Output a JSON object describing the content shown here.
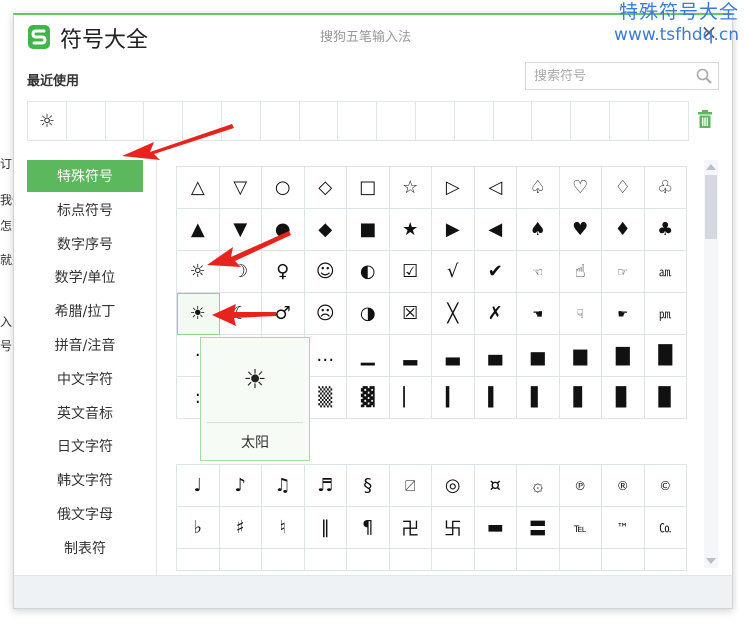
{
  "background_text": [
    "订",
    "我们",
    "怎么",
    "就是",
    "入,",
    "号"
  ],
  "window": {
    "title": "符号大全",
    "ime_name": "搜狗五笔输入法",
    "close_icon": "close-icon",
    "recent_label": "最近使用",
    "search": {
      "placeholder": "搜索符号",
      "value": ""
    },
    "recent_symbols": [
      "☼",
      "",
      "",
      "",
      "",
      "",
      "",
      "",
      "",
      "",
      "",
      "",
      "",
      "",
      "",
      "",
      ""
    ],
    "accent_color": "#5cb85c"
  },
  "categories": [
    {
      "label": "特殊符号",
      "active": true
    },
    {
      "label": "标点符号",
      "active": false
    },
    {
      "label": "数字序号",
      "active": false
    },
    {
      "label": "数学/单位",
      "active": false
    },
    {
      "label": "希腊/拉丁",
      "active": false
    },
    {
      "label": "拼音/注音",
      "active": false
    },
    {
      "label": "中文字符",
      "active": false
    },
    {
      "label": "英文音标",
      "active": false
    },
    {
      "label": "日文字符",
      "active": false
    },
    {
      "label": "韩文字符",
      "active": false
    },
    {
      "label": "俄文字母",
      "active": false
    },
    {
      "label": "制表符",
      "active": false
    }
  ],
  "symbol_grid_1": [
    [
      "△",
      "▽",
      "○",
      "◇",
      "□",
      "☆",
      "▷",
      "◁",
      "♤",
      "♡",
      "♢",
      "♧"
    ],
    [
      "▲",
      "▼",
      "●",
      "◆",
      "■",
      "★",
      "▶",
      "◀",
      "♠",
      "♥",
      "♦",
      "♣"
    ],
    [
      "☼",
      "☽",
      "♀",
      "☺",
      "◐",
      "☑",
      "√",
      "✔",
      "☜",
      "☝",
      "☞",
      "㏂"
    ],
    [
      "☀",
      "☾",
      "♂",
      "☹",
      "◑",
      "☒",
      "╳",
      "✗",
      "☚",
      "☟",
      "☛",
      "㏘"
    ],
    [
      "·",
      "",
      "",
      "…",
      "▁",
      "▂",
      "▃",
      "▄",
      "▅",
      "▆",
      "▇",
      "█"
    ],
    [
      ":",
      "",
      "",
      "▒",
      "▓",
      "▏",
      "▎",
      "▍",
      "▌",
      "▋",
      "▊",
      "▉"
    ]
  ],
  "symbol_grid_2": [
    [
      "♩",
      "♪",
      "♫",
      "♬",
      "§",
      "〼",
      "◎",
      "¤",
      "۞",
      "℗",
      "®",
      "©"
    ],
    [
      "♭",
      "♯",
      "♮",
      "‖",
      "¶",
      "卍",
      "卐",
      "▬",
      "〓",
      "℡",
      "™",
      "㏇"
    ],
    [
      "",
      "",
      "",
      "",
      "",
      "",
      "",
      "",
      "",
      "",
      "",
      ""
    ]
  ],
  "tooltip": {
    "symbol": "☀",
    "name": "太阳"
  },
  "watermark": {
    "line1": "特殊符号大全",
    "line2": "www.tsfhdq.cn"
  }
}
